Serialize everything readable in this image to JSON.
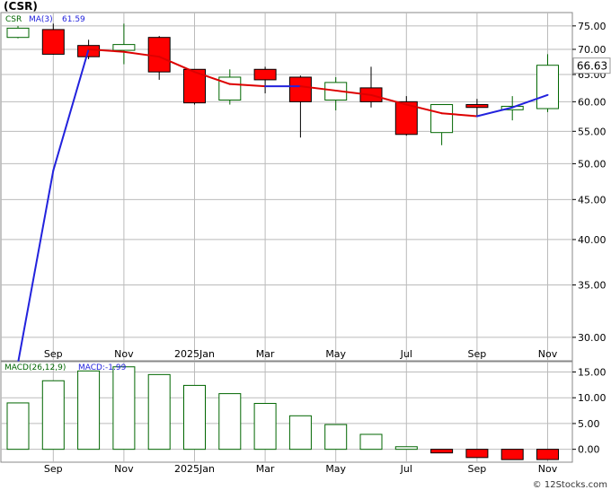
{
  "title": "(CSR)",
  "watermark": "© 12Stocks.com",
  "colors": {
    "up_fill": "#ffffff",
    "up_stroke": "#006600",
    "down_fill": "#ff0000",
    "ma_up": "#2222dd",
    "ma_down": "#dd0000",
    "grid": "#bbbbbb",
    "price_badge_bg": "#ffffff"
  },
  "chart_data": [
    {
      "type": "candlestick",
      "ticker": "CSR",
      "legend": {
        "ticker": "CSR",
        "ma_label": "MA(3)",
        "ma_value": "61.59"
      },
      "last_price": "66.63",
      "scale": "log",
      "ylim": [
        28,
        78
      ],
      "y_ticks": [
        "75.00",
        "70.00",
        "65.00",
        "60.00",
        "55.00",
        "50.00",
        "45.00",
        "40.00",
        "35.00",
        "30.00"
      ],
      "x_labels": [
        "Sep",
        "Nov",
        "2025Jan",
        "Mar",
        "May",
        "Jul",
        "Sep",
        "Nov"
      ],
      "x_label_positions": [
        1,
        3,
        5,
        7,
        9,
        11,
        13,
        15
      ],
      "candles": [
        {
          "open": 72.5,
          "close": 74.5,
          "high": 75.0,
          "low": 72.3
        },
        {
          "open": 74.2,
          "close": 69.0,
          "high": 75.5,
          "low": 68.9
        },
        {
          "open": 70.8,
          "close": 68.5,
          "high": 72.0,
          "low": 68.0
        },
        {
          "open": 69.8,
          "close": 71.0,
          "high": 75.5,
          "low": 67.0
        },
        {
          "open": 72.5,
          "close": 65.5,
          "high": 72.8,
          "low": 64.0
        },
        {
          "open": 66.0,
          "close": 59.8,
          "high": 66.0,
          "low": 59.5
        },
        {
          "open": 60.3,
          "close": 64.5,
          "high": 66.0,
          "low": 59.5
        },
        {
          "open": 66.0,
          "close": 64.0,
          "high": 66.5,
          "low": 61.5
        },
        {
          "open": 64.5,
          "close": 60.0,
          "high": 64.8,
          "low": 54.0
        },
        {
          "open": 60.3,
          "close": 63.5,
          "high": 64.5,
          "low": 58.5
        },
        {
          "open": 62.5,
          "close": 60.0,
          "high": 66.5,
          "low": 59.0
        },
        {
          "open": 60.0,
          "close": 54.5,
          "high": 61.0,
          "low": 54.3
        },
        {
          "open": 54.8,
          "close": 59.5,
          "high": 59.5,
          "low": 52.8
        },
        {
          "open": 59.5,
          "close": 59.0,
          "high": 60.5,
          "low": 57.5
        },
        {
          "open": 58.6,
          "close": 59.2,
          "high": 61.0,
          "low": 56.8
        },
        {
          "open": 58.8,
          "close": 66.8,
          "high": 69.0,
          "low": 58.2
        }
      ],
      "ma": [
        27.8,
        49.0,
        70.0,
        69.5,
        68.5,
        65.5,
        63.2,
        62.8,
        62.8,
        62.0,
        61.2,
        59.5,
        58.0,
        57.5,
        59.0,
        61.2
      ]
    },
    {
      "type": "bar",
      "legend": {
        "label": "MACD(26,12,9)",
        "value_label": "MACD:-1.99"
      },
      "ylim": [
        -2.5,
        17
      ],
      "y_ticks": [
        "15.00",
        "10.00",
        "5.00",
        "0.00"
      ],
      "x_labels": [
        "Sep",
        "Nov",
        "2025Jan",
        "Mar",
        "May",
        "Jul",
        "Sep",
        "Nov"
      ],
      "x_label_positions": [
        1,
        3,
        5,
        7,
        9,
        11,
        13,
        15
      ],
      "values": [
        9.0,
        13.3,
        15.2,
        16.0,
        14.5,
        12.4,
        10.8,
        8.9,
        6.5,
        4.8,
        2.9,
        0.5,
        -0.7,
        -1.6,
        -2.0,
        -1.99
      ]
    }
  ]
}
